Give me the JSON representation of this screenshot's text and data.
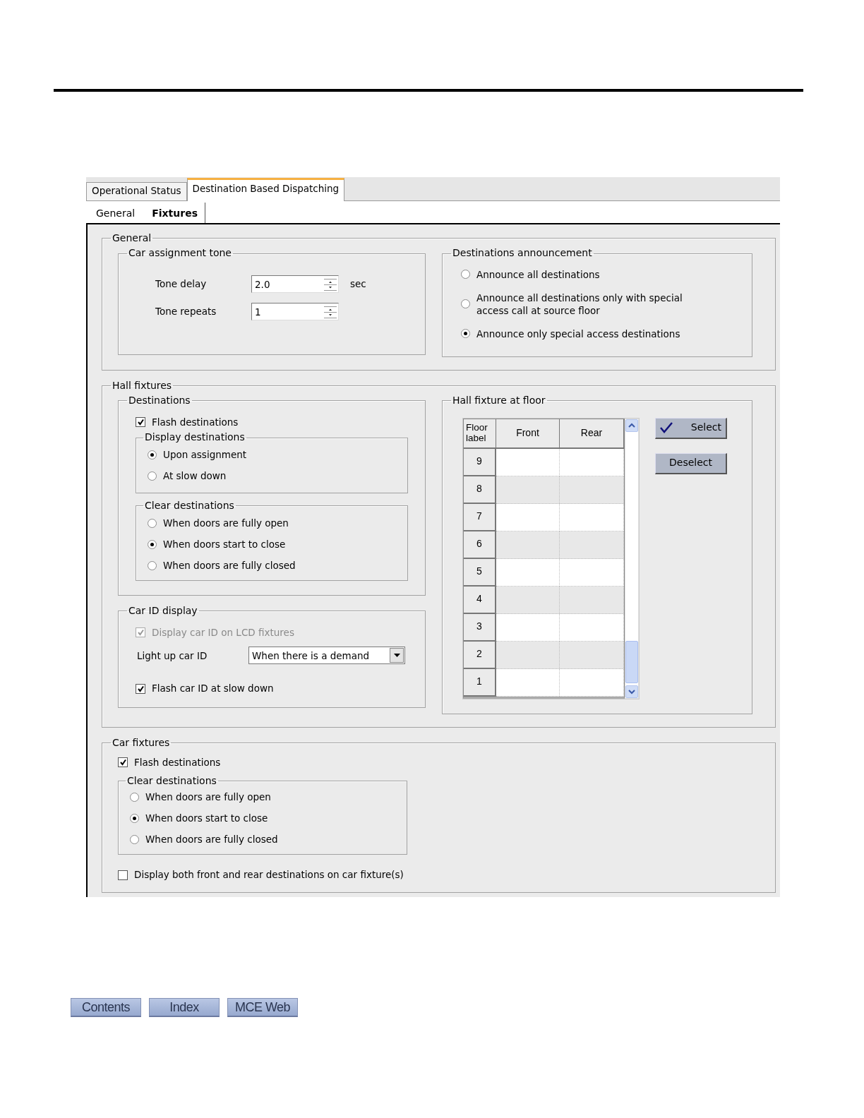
{
  "tabs": [
    {
      "label": "Operational Status",
      "selected": false
    },
    {
      "label": "Destination Based Dispatching",
      "selected": true
    }
  ],
  "subtabs": [
    {
      "label": "General",
      "selected": false
    },
    {
      "label": "Fixtures",
      "selected": true
    }
  ],
  "general": {
    "title": "General",
    "car_assignment_tone": {
      "title": "Car assignment tone",
      "fields": [
        {
          "label": "Tone delay",
          "value": "2.0",
          "unit": "sec"
        },
        {
          "label": "Tone repeats",
          "value": "1"
        }
      ]
    },
    "destinations_announcement": {
      "title": "Destinations announcement",
      "options": [
        {
          "label": "Announce all destinations",
          "selected": false
        },
        {
          "label": "Announce all destinations only with special access call at source floor",
          "selected": false
        },
        {
          "label": "Announce only special access destinations",
          "selected": true
        }
      ]
    }
  },
  "hall_fixtures": {
    "title": "Hall fixtures",
    "destinations": {
      "title": "Destinations",
      "flash": {
        "label": "Flash destinations",
        "checked": true
      },
      "display": {
        "title": "Display destinations",
        "options": [
          {
            "label": "Upon assignment",
            "selected": true
          },
          {
            "label": "At slow down",
            "selected": false
          }
        ]
      },
      "clear": {
        "title": "Clear destinations",
        "options": [
          {
            "label": "When doors are fully open",
            "selected": false
          },
          {
            "label": "When doors start to close",
            "selected": true
          },
          {
            "label": "When doors are fully closed",
            "selected": false
          }
        ]
      }
    },
    "car_id_display": {
      "title": "Car ID display",
      "display_on_lcd": {
        "label": "Display car ID on LCD fixtures",
        "checked": true,
        "disabled": true
      },
      "light_up": {
        "label": "Light up car ID",
        "value": "When there is a demand"
      },
      "flash": {
        "label": "Flash car ID at slow down",
        "checked": true,
        "disabled": false
      }
    },
    "hall_fixture_at_floor": {
      "title": "Hall fixture at floor",
      "columns": [
        "Floor label",
        "Front",
        "Rear"
      ],
      "rows": [
        "9",
        "8",
        "7",
        "6",
        "5",
        "4",
        "3",
        "2",
        "1"
      ],
      "buttons": [
        {
          "label": "Select",
          "kind": "check"
        },
        {
          "label": "Deselect",
          "kind": "plain"
        }
      ]
    }
  },
  "car_fixtures": {
    "title": "Car fixtures",
    "flash": {
      "label": "Flash destinations",
      "checked": true
    },
    "clear": {
      "title": "Clear destinations",
      "options": [
        {
          "label": "When doors are fully open",
          "selected": false
        },
        {
          "label": "When doors start to close",
          "selected": true
        },
        {
          "label": "When doors are fully closed",
          "selected": false
        }
      ]
    },
    "display_both": {
      "label": "Display both front and rear destinations on car fixture(s)",
      "checked": false
    }
  },
  "footer_buttons": [
    "Contents",
    "Index",
    "MCE Web"
  ]
}
